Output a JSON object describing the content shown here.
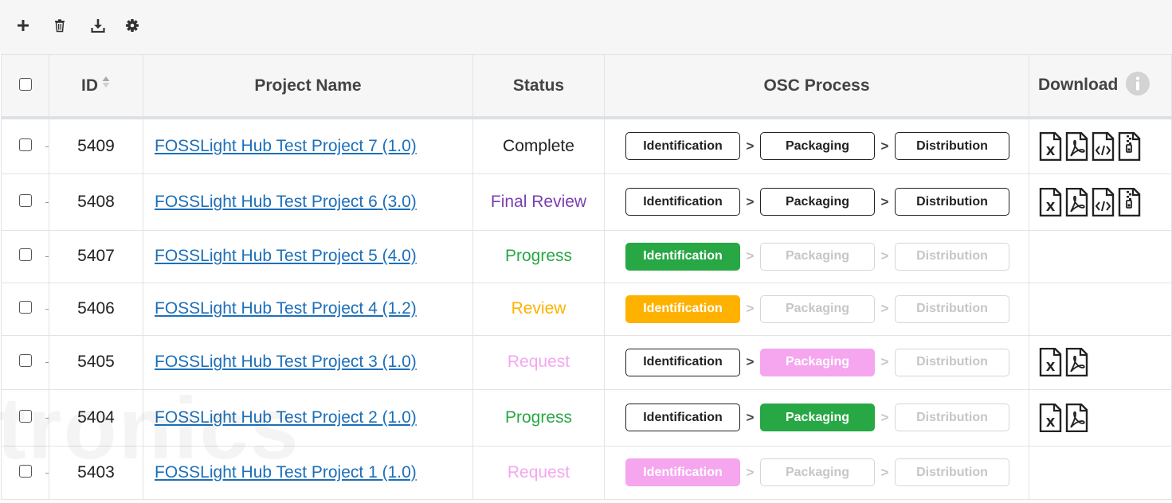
{
  "toolbar": {
    "add_icon": "plus-icon",
    "delete_icon": "trash-icon",
    "download_icon": "download-icon",
    "settings_icon": "gear-icon"
  },
  "columns": {
    "id": "ID",
    "project_name": "Project Name",
    "status": "Status",
    "osc_process": "OSC Process",
    "download": "Download"
  },
  "process_steps": [
    "Identification",
    "Packaging",
    "Distribution"
  ],
  "process_separator": ">",
  "colors": {
    "complete": "#222222",
    "final_review": "#7a3fb0",
    "progress": "#28a745",
    "review": "#ffb100",
    "request": "#f5a6ef",
    "link": "#1d6fb8"
  },
  "watermark": "tronics",
  "rows": [
    {
      "id": "5409",
      "name": "FOSSLight Hub Test Project 7 (1.0)",
      "status": "Complete",
      "status_color": "#222222",
      "steps": [
        "active",
        "active",
        "active"
      ],
      "downloads": [
        "excel",
        "pdf",
        "code",
        "zip"
      ]
    },
    {
      "id": "5408",
      "name": "FOSSLight Hub Test Project 6 (3.0)",
      "status": "Final Review",
      "status_color": "#7a3fb0",
      "steps": [
        "active",
        "active",
        "active"
      ],
      "downloads": [
        "excel",
        "pdf",
        "code",
        "zip"
      ]
    },
    {
      "id": "5407",
      "name": "FOSSLight Hub Test Project 5 (4.0)",
      "status": "Progress",
      "status_color": "#28a745",
      "steps": [
        "green",
        "inactive",
        "inactive"
      ],
      "downloads": []
    },
    {
      "id": "5406",
      "name": "FOSSLight Hub Test Project 4 (1.2)",
      "status": "Review",
      "status_color": "#ffb100",
      "steps": [
        "orange",
        "inactive",
        "inactive"
      ],
      "downloads": []
    },
    {
      "id": "5405",
      "name": "FOSSLight Hub Test Project 3 (1.0)",
      "status": "Request",
      "status_color": "#f5a6ef",
      "steps": [
        "active",
        "pink",
        "inactive"
      ],
      "downloads": [
        "excel",
        "pdf"
      ]
    },
    {
      "id": "5404",
      "name": "FOSSLight Hub Test Project 2 (1.0)",
      "status": "Progress",
      "status_color": "#28a745",
      "steps": [
        "active",
        "green",
        "inactive"
      ],
      "downloads": [
        "excel",
        "pdf"
      ]
    },
    {
      "id": "5403",
      "name": "FOSSLight Hub Test Project 1 (1.0)",
      "status": "Request",
      "status_color": "#f5a6ef",
      "steps": [
        "pink",
        "inactive",
        "inactive"
      ],
      "downloads": []
    }
  ]
}
